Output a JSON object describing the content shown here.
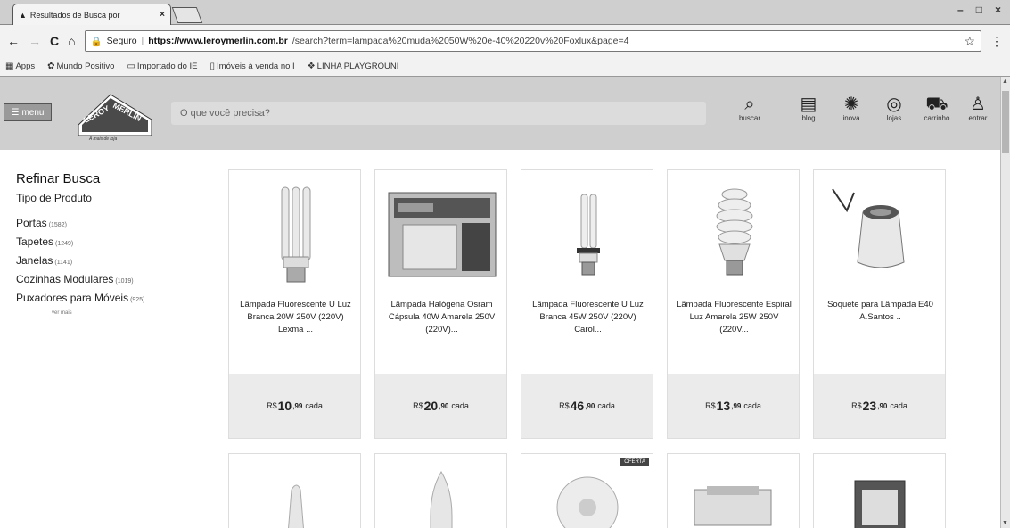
{
  "browser": {
    "tab_title": "Resultados de Busca por",
    "tab_close": "×",
    "window_buttons": [
      "–",
      "□",
      "×"
    ],
    "nav": {
      "back": "←",
      "forward": "→",
      "reload": "C",
      "home": "⌂"
    },
    "secure_label": "Seguro",
    "url_host": "https://www.leroymerlin.com.br",
    "url_rest": "/search?term=lampada%20muda%2050W%20e-40%20220v%20Foxlux&page=4",
    "bookmarks": [
      {
        "icon": "apps-icon",
        "label": "Apps"
      },
      {
        "icon": "mundo-positivo-icon",
        "label": "Mundo Positivo"
      },
      {
        "icon": "folder-icon",
        "label": "Importado do IE"
      },
      {
        "icon": "page-icon",
        "label": "Imóveis à venda no I"
      },
      {
        "icon": "playground-icon",
        "label": "LINHA PLAYGROUNI"
      }
    ]
  },
  "header": {
    "menu_label": "menu",
    "logo_text": "LEROY MERLIN",
    "logo_tagline": "A mais de loja",
    "search_placeholder": "O que você precisa?",
    "search_label": "buscar",
    "icons": [
      {
        "name": "blog",
        "label": "blog"
      },
      {
        "name": "inova",
        "label": "inova"
      },
      {
        "name": "lojas",
        "label": "lojas"
      },
      {
        "name": "carrinho",
        "label": "carrinho"
      },
      {
        "name": "entrar",
        "label": "entrar"
      }
    ]
  },
  "sidebar": {
    "title": "Refinar Busca",
    "subtitle": "Tipo de Produto",
    "items": [
      {
        "label": "Portas",
        "count": "(1582)"
      },
      {
        "label": "Tapetes",
        "count": "(1249)"
      },
      {
        "label": "Janelas",
        "count": "(1141)"
      },
      {
        "label": "Cozinhas Modulares",
        "count": "(1019)"
      },
      {
        "label": "Puxadores para Móveis",
        "count": "(925)"
      }
    ],
    "more_label": "ver mais"
  },
  "products": [
    {
      "name": "Lâmpada Fluorescente U Luz Branca 20W 250V (220V) Lexma ...",
      "currency": "R$",
      "int": "10",
      "cents": "99",
      "unit": "cada"
    },
    {
      "name": "Lâmpada Halógena Osram Cápsula 40W Amarela 250V (220V)...",
      "currency": "R$",
      "int": "20",
      "cents": "90",
      "unit": "cada"
    },
    {
      "name": "Lâmpada Fluorescente U Luz Branca 45W 250V (220V) Carol...",
      "currency": "R$",
      "int": "46",
      "cents": "90",
      "unit": "cada"
    },
    {
      "name": "Lâmpada Fluorescente Espiral Luz Amarela 25W 250V (220V...",
      "currency": "R$",
      "int": "13",
      "cents": "99",
      "unit": "cada"
    },
    {
      "name": "Soquete para Lâmpada E40 A.Santos ..",
      "currency": "R$",
      "int": "23",
      "cents": "90",
      "unit": "cada"
    }
  ],
  "row2_badge": "OFERTA"
}
